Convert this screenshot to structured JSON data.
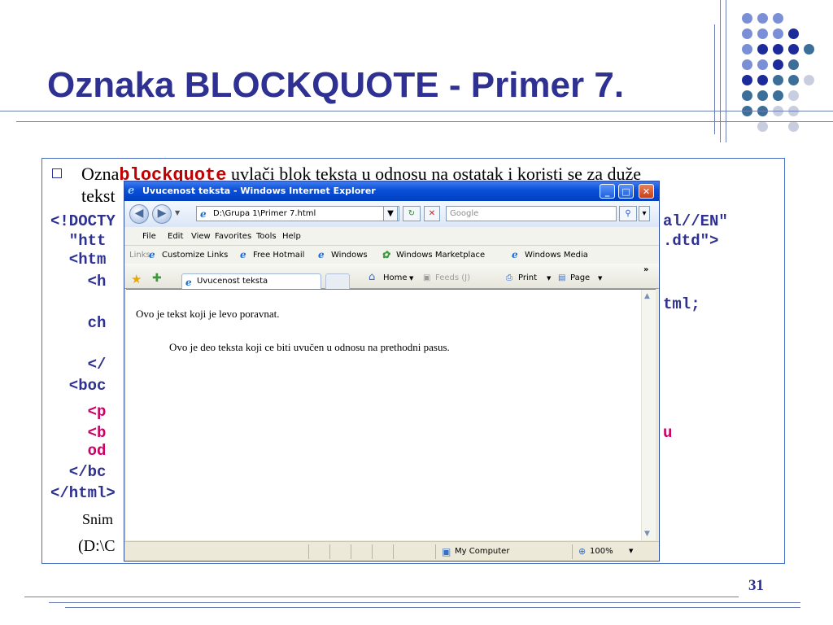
{
  "slide": {
    "title": "Oznaka BLOCKQUOTE - Primer 7.",
    "bullet_pre": "Ozna",
    "bullet_kw": "blockquote",
    "bullet_post": " uvlači blok teksta u odnosu na ostatak i koristi se za duže",
    "bullet_line2": "tekst",
    "code_lines": [
      {
        "text": "<!DOCTY",
        "color": "#2e3192"
      },
      {
        "text": "  \"htt",
        "color": "#2e3192"
      },
      {
        "text": "  <htm",
        "color": "#2e3192"
      },
      {
        "text": "    <h",
        "color": "#2e3192"
      },
      {
        "text": "    ch",
        "color": "#2e3192"
      },
      {
        "text": "    </",
        "color": "#2e3192"
      },
      {
        "text": "  <boc",
        "color": "#2e3192"
      },
      {
        "text": "    <p",
        "color": "#cc0066"
      },
      {
        "text": "    <b",
        "color": "#cc0066"
      },
      {
        "text": "    od",
        "color": "#cc0066"
      },
      {
        "text": "  </bc",
        "color": "#2e3192"
      },
      {
        "text": "</html>",
        "color": "#2e3192"
      }
    ],
    "code_right": [
      "al//EN\"",
      ".dtd\">",
      "tml;",
      "u"
    ],
    "snim": "Snim",
    "path_partial": "(D:\\C",
    "page_number": "31"
  },
  "browser": {
    "window_title": "Uvucenost teksta - Windows Internet Explorer",
    "address": "D:\\Grupa 1\\Primer 7.html",
    "search_placeholder": "Google",
    "menu": [
      "File",
      "Edit",
      "View",
      "Favorites",
      "Tools",
      "Help"
    ],
    "links_label": "Links",
    "links": [
      "Customize Links",
      "Free Hotmail",
      "Windows",
      "Windows Marketplace",
      "Windows Media"
    ],
    "tab_title": "Uvucenost teksta",
    "toolbar": {
      "home": "Home",
      "feeds": "Feeds (J)",
      "print": "Print",
      "page": "Page"
    },
    "content": {
      "p1": "Ovo je tekst koji je levo poravnat.",
      "p2": "Ovo je deo teksta koji ce biti uvučen u odnosu na prethodni pasus."
    },
    "status": {
      "zone": "My Computer",
      "zoom": "100%"
    }
  }
}
